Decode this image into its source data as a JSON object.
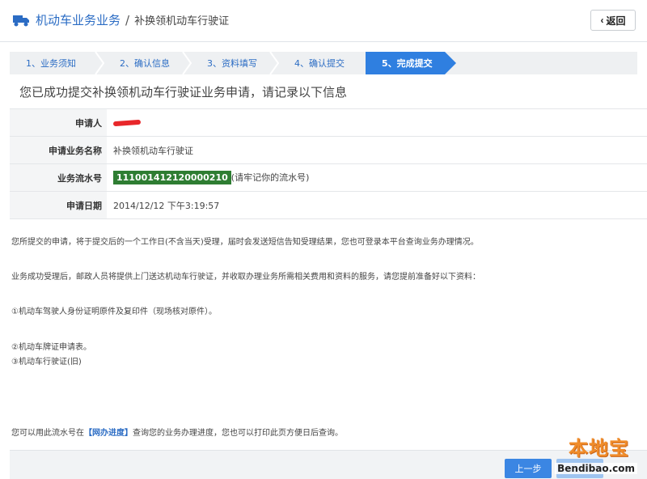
{
  "header": {
    "title": "机动车业务业务",
    "separator": "/",
    "subtitle": "补换领机动车行驶证",
    "back_label": "返回"
  },
  "steps": [
    {
      "label": "1、业务须知",
      "active": false
    },
    {
      "label": "2、确认信息",
      "active": false
    },
    {
      "label": "3、资料填写",
      "active": false
    },
    {
      "label": "4、确认提交",
      "active": false
    },
    {
      "label": "5、完成提交",
      "active": true
    }
  ],
  "success_message": "您已成功提交补换领机动车行驶证业务申请，请记录以下信息",
  "info": {
    "applicant_label": "申请人",
    "business_name_label": "申请业务名称",
    "business_name_value": "补换领机动车行驶证",
    "serial_label": "业务流水号",
    "serial_value": "111001412120000210",
    "serial_hint": "(请牢记你的流水号)",
    "date_label": "申请日期",
    "date_value": "2014/12/12 下午3:19:57"
  },
  "notes": {
    "line1": "您所提交的申请，将于提交后的一个工作日(不含当天)受理，届时会发送短信告知受理结果，您也可登录本平台查询业务办理情况。",
    "line2": "业务成功受理后，邮政人员将提供上门送达机动车行驶证，并收取办理业务所需相关费用和资料的服务，请您提前准备好以下资料：",
    "line3": "①机动车驾驶人身份证明原件及复印件（现场核对原件）。",
    "line4": "②机动车牌证申请表。",
    "line5": "③机动车行驶证(旧)",
    "line6_prefix": "您可以用此流水号在",
    "line6_link": "【网办进度】",
    "line6_suffix": "查询您的业务办理进度，您也可以打印此页方便日后查询。"
  },
  "footer": {
    "prev_label": "上一步"
  },
  "watermark": {
    "cn": "本地宝",
    "en": "Bendibao.com"
  },
  "colors": {
    "accent": "#2f7fe0",
    "link": "#2b6cc4",
    "serial_bg": "#2e7d32",
    "redaction": "#e8272a",
    "watermark": "#f08c2a"
  }
}
